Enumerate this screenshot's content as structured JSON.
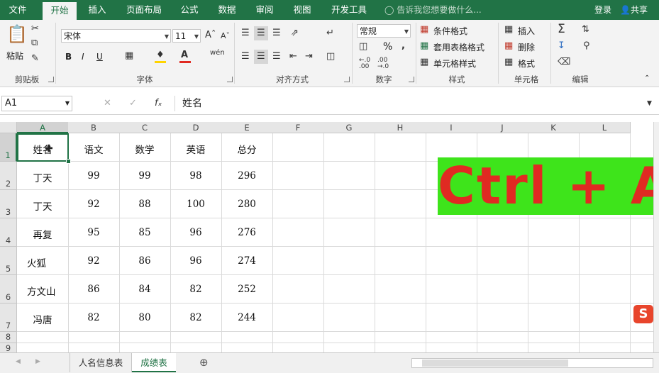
{
  "ribbon_tabs": [
    "文件",
    "开始",
    "插入",
    "页面布局",
    "公式",
    "数据",
    "审阅",
    "视图",
    "开发工具"
  ],
  "active_tab": "开始",
  "tell_me": "告诉我您想要做什么...",
  "login": "登录",
  "share": "共享",
  "groups": {
    "clipboard": {
      "label": "剪贴板",
      "paste": "粘贴"
    },
    "font": {
      "label": "字体",
      "font_name": "宋体",
      "font_size": "11",
      "bold": "B",
      "italic": "I",
      "underline": "U"
    },
    "alignment": {
      "label": "对齐方式"
    },
    "number": {
      "label": "数字",
      "format": "常规",
      "percent": "%"
    },
    "styles": {
      "label": "样式",
      "conditional": "条件格式",
      "table": "套用表格格式",
      "cell_styles": "单元格样式"
    },
    "cells": {
      "label": "单元格",
      "insert": "插入",
      "delete": "删除",
      "format": "格式"
    },
    "editing": {
      "label": "编辑"
    }
  },
  "name_box": "A1",
  "formula_value": "姓名",
  "columns": [
    "A",
    "B",
    "C",
    "D",
    "E",
    "F",
    "G",
    "H",
    "I",
    "J",
    "K",
    "L"
  ],
  "row_numbers": [
    "1",
    "2",
    "3",
    "4",
    "5",
    "6",
    "7",
    "8",
    "9"
  ],
  "table": {
    "headers": [
      "姓名",
      "语文",
      "数学",
      "英语",
      "总分"
    ],
    "rows": [
      [
        "丁天",
        "99",
        "99",
        "98",
        "296"
      ],
      [
        "丁天",
        "92",
        "88",
        "100",
        "280"
      ],
      [
        "再复",
        "95",
        "85",
        "96",
        "276"
      ],
      [
        "火狐",
        "92",
        "86",
        "96",
        "274"
      ],
      [
        "方文山",
        "86",
        "84",
        "82",
        "252"
      ],
      [
        "冯唐",
        "82",
        "80",
        "82",
        "244"
      ]
    ]
  },
  "banner_text": "Ctrl + A",
  "ime_label": "S",
  "sheets": [
    "人名信息表",
    "成绩表"
  ],
  "active_sheet": "成绩表",
  "colors": {
    "accent": "#217346",
    "banner_bg": "#3ee41b",
    "banner_fg": "#e02a22"
  }
}
